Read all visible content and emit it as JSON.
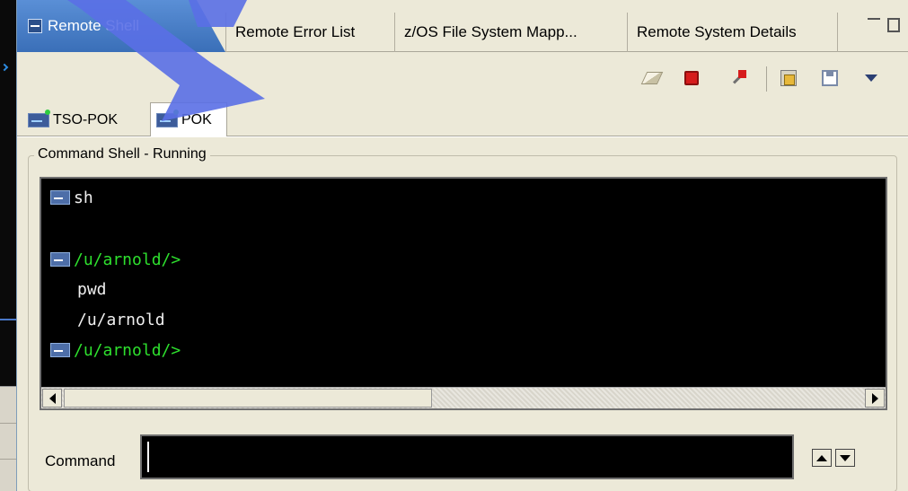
{
  "view_tabs": {
    "active_label": "Remote Shell",
    "tab2_label": "Remote Error List",
    "tab3_label": "z/OS File System Mapp...",
    "tab4_label": "Remote System Details"
  },
  "shell_tabs": {
    "tab1_label": "TSO-POK",
    "tab2_label": "POK"
  },
  "group": {
    "legend": "Command Shell - Running"
  },
  "console": {
    "line1": "sh",
    "line2": "/u/arnold/>",
    "line3": "pwd",
    "line4": "/u/arnold",
    "line5": "/u/arnold/>"
  },
  "command": {
    "label": "Command",
    "value": ""
  },
  "colors": {
    "prompt": "#2ee02e",
    "console_bg": "#000000",
    "panel_bg": "#ece9d8",
    "active_tab": "#3a6fb8"
  },
  "icons": {
    "view_tab": "remote-shell-icon",
    "toolbar": [
      "clear-icon",
      "terminate-icon",
      "remove-icon",
      "export-icon",
      "save-icon",
      "menu-dropdown-icon"
    ],
    "shell_tab": "shell-connection-icon"
  }
}
